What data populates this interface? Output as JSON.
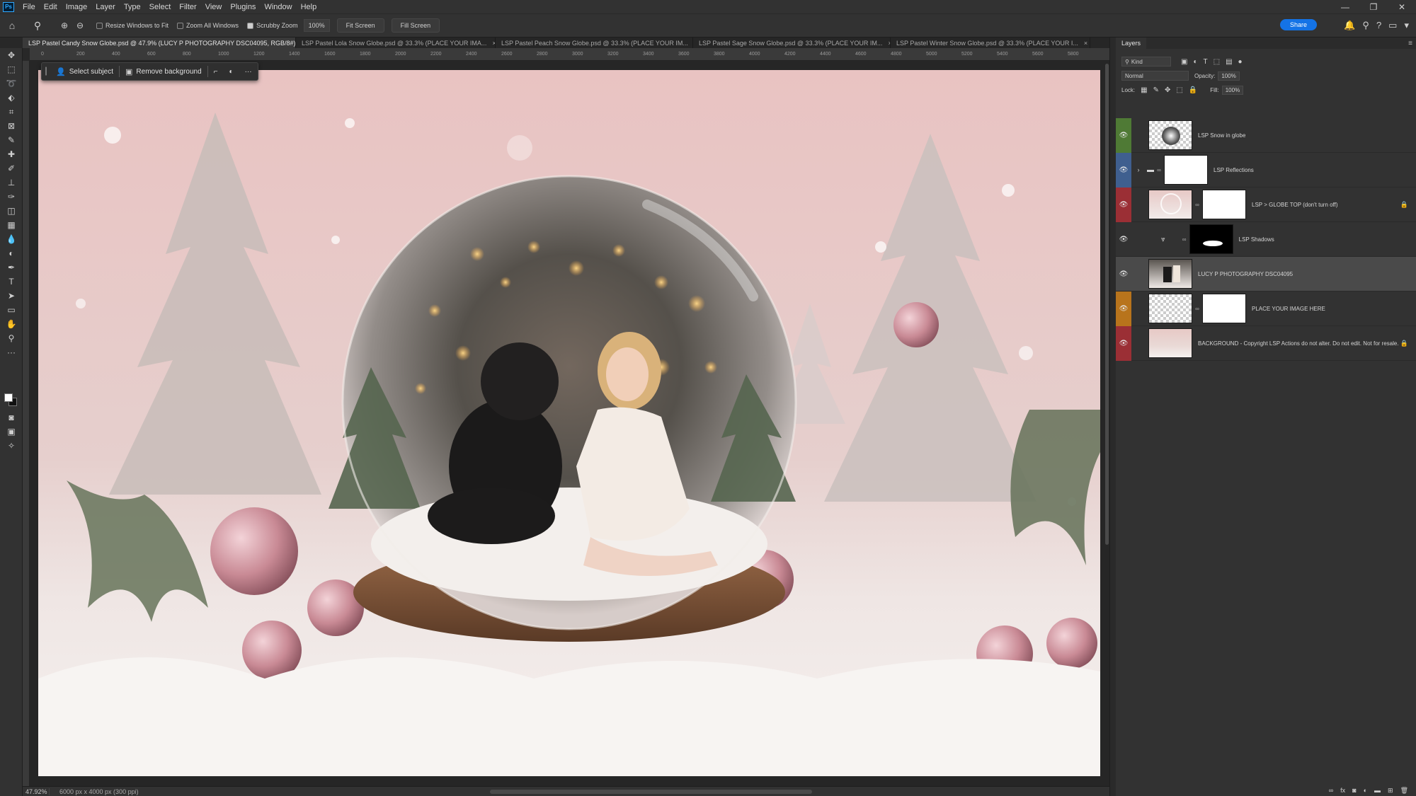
{
  "app": {
    "logo": "Ps",
    "menu": [
      "File",
      "Edit",
      "Image",
      "Layer",
      "Type",
      "Select",
      "Filter",
      "View",
      "Plugins",
      "Window",
      "Help"
    ],
    "window_controls": [
      "—",
      "❐",
      "✕"
    ]
  },
  "options_bar": {
    "resize_windows": "Resize Windows to Fit",
    "zoom_all": "Zoom All Windows",
    "scrubby_zoom": "Scrubby Zoom",
    "zoom_value": "100%",
    "fit_screen": "Fit Screen",
    "fill_screen": "Fill Screen",
    "share": "Share"
  },
  "tabs": [
    {
      "label": "LSP Pastel Candy Snow Globe.psd @ 47.9% (LUCY P PHOTOGRAPHY DSC04095, RGB/8#) *",
      "active": true
    },
    {
      "label": "LSP Pastel Lola Snow Globe.psd @ 33.3% (PLACE YOUR IMA...",
      "active": false
    },
    {
      "label": "LSP Pastel Peach Snow Globe.psd @ 33.3% (PLACE YOUR IM...",
      "active": false
    },
    {
      "label": "LSP Pastel Sage Snow Globe.psd @ 33.3% (PLACE YOUR IM...",
      "active": false
    },
    {
      "label": "LSP Pastel Winter Snow Globe.psd @ 33.3% (PLACE YOUR I...",
      "active": false
    }
  ],
  "ruler_ticks": [
    "0",
    "200",
    "400",
    "600",
    "800",
    "1000",
    "1200",
    "1400",
    "1600",
    "1800",
    "2000",
    "2200",
    "2400",
    "2600",
    "2800",
    "3000",
    "3200",
    "3400",
    "3600",
    "3800",
    "4000",
    "4200",
    "4400",
    "4600",
    "4800",
    "5000",
    "5200",
    "5400",
    "5600",
    "5800"
  ],
  "context_bar": {
    "select_subject": "Select subject",
    "remove_background": "Remove background",
    "more": "···"
  },
  "status": {
    "zoom": "47.92%",
    "doc_size": "6000 px x 4000 px (300 ppi)"
  },
  "layers_panel": {
    "title": "Layers",
    "kind": "Kind",
    "blend_mode": "Normal",
    "opacity_label": "Opacity:",
    "opacity_value": "100%",
    "lock_label": "Lock:",
    "fill_label": "Fill:",
    "fill_value": "100%",
    "layers": [
      {
        "name": "LSP Snow in globe",
        "color": "#4f7a35",
        "selected": false,
        "locked": false
      },
      {
        "name": "LSP Reflections",
        "color": "#3f5f8f",
        "selected": false,
        "locked": false
      },
      {
        "name": "LSP > GLOBE TOP (don't turn off)",
        "color": "#9b2f35",
        "selected": false,
        "locked": true
      },
      {
        "name": "LSP Shadows",
        "color": "",
        "selected": false,
        "locked": false
      },
      {
        "name": "LUCY P PHOTOGRAPHY DSC04095",
        "color": "",
        "selected": true,
        "locked": false
      },
      {
        "name": "PLACE YOUR IMAGE HERE",
        "color": "#b8741c",
        "selected": false,
        "locked": false
      },
      {
        "name": "BACKGROUND - Copyright LSP Actions do not alter. Do not edit. Not for resale.",
        "color": "#9b2f35",
        "selected": false,
        "locked": true
      }
    ],
    "footer_icons": [
      "link-icon",
      "fx-icon",
      "mask-icon",
      "adjustment-icon",
      "folder-icon",
      "new-layer-icon",
      "trash-icon"
    ]
  }
}
